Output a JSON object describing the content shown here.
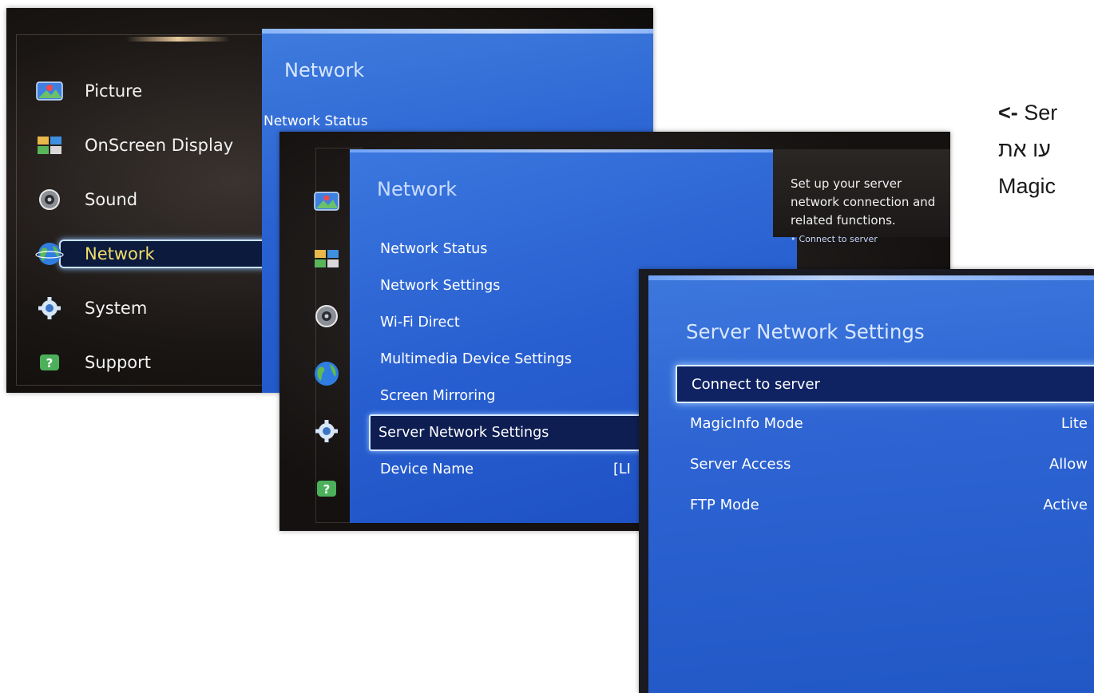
{
  "screens": [
    {
      "id": "tv-main-menu",
      "menu": [
        {
          "label": "Picture",
          "icon": "picture-icon"
        },
        {
          "label": "OnScreen Display",
          "icon": "onscreen-display-icon"
        },
        {
          "label": "Sound",
          "icon": "sound-icon"
        },
        {
          "label": "Network",
          "icon": "network-globe-icon",
          "selected": true
        },
        {
          "label": "System",
          "icon": "system-gear-icon"
        },
        {
          "label": "Support",
          "icon": "support-icon"
        }
      ],
      "panel_title": "Network",
      "panel_first_item": "Network Status"
    },
    {
      "id": "tv-network-menu",
      "panel_title": "Network",
      "items": [
        {
          "label": "Network Status",
          "value": ""
        },
        {
          "label": "Network Settings",
          "value": ""
        },
        {
          "label": "Wi-Fi Direct",
          "value": ""
        },
        {
          "label": "Multimedia Device Settings",
          "value": ""
        },
        {
          "label": "Screen Mirroring",
          "value": ""
        },
        {
          "label": "Server Network Settings",
          "value": "",
          "selected": true
        },
        {
          "label": "Device Name",
          "value": "[LI"
        }
      ],
      "help": {
        "lines": [
          "Set up your server",
          "network connection and",
          "related functions."
        ],
        "bullet": "Connect to server"
      }
    },
    {
      "id": "tv-server-network-settings",
      "panel_title": "Server Network Settings",
      "items": [
        {
          "label": "Connect to server",
          "value": "",
          "selected": true
        },
        {
          "label": "MagicInfo Mode",
          "value": "Lite"
        },
        {
          "label": "Server Access",
          "value": "Allow"
        },
        {
          "label": "FTP Mode",
          "value": "Active"
        }
      ]
    }
  ],
  "annotation": {
    "line1_arrow": "<-",
    "line1_text": "Ser",
    "line2": "עו את",
    "line3": "Magic"
  },
  "colors": {
    "panel_blue": "#2a62d2",
    "selection_fill": "#0e1e52",
    "selected_label_yellow": "#f0dc6a"
  }
}
